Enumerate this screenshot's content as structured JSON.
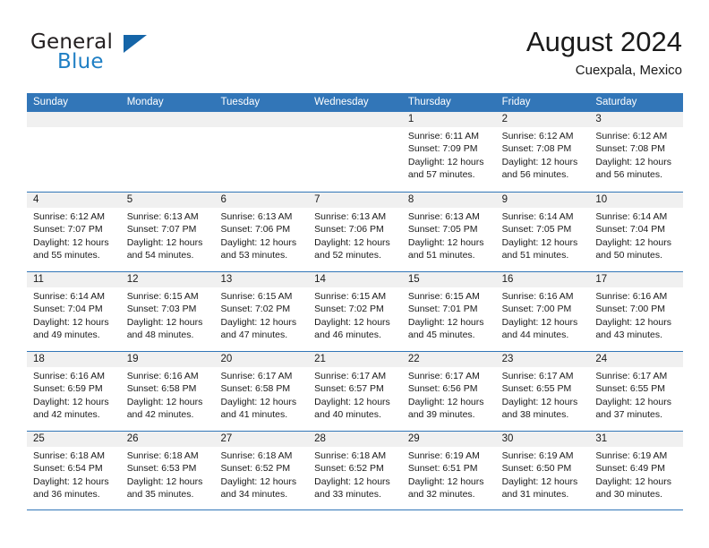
{
  "brand": {
    "line1": "General",
    "line2": "Blue",
    "logo_icon": "blue-triangle-logo",
    "accent_color": "#1f7fc4"
  },
  "header": {
    "title": "August 2024",
    "subtitle": "Cuexpala, Mexico"
  },
  "theme": {
    "header_blue": "#3276b8",
    "day_band_gray": "#f0f0f0",
    "text_color": "#1a1a1a"
  },
  "calendar": {
    "weekday_headers": [
      "Sunday",
      "Monday",
      "Tuesday",
      "Wednesday",
      "Thursday",
      "Friday",
      "Saturday"
    ],
    "weeks": [
      [
        {
          "day": "",
          "empty": true
        },
        {
          "day": "",
          "empty": true
        },
        {
          "day": "",
          "empty": true
        },
        {
          "day": "",
          "empty": true
        },
        {
          "day": "1",
          "sunrise": "Sunrise: 6:11 AM",
          "sunset": "Sunset: 7:09 PM",
          "daylight1": "Daylight: 12 hours",
          "daylight2": "and 57 minutes."
        },
        {
          "day": "2",
          "sunrise": "Sunrise: 6:12 AM",
          "sunset": "Sunset: 7:08 PM",
          "daylight1": "Daylight: 12 hours",
          "daylight2": "and 56 minutes."
        },
        {
          "day": "3",
          "sunrise": "Sunrise: 6:12 AM",
          "sunset": "Sunset: 7:08 PM",
          "daylight1": "Daylight: 12 hours",
          "daylight2": "and 56 minutes."
        }
      ],
      [
        {
          "day": "4",
          "sunrise": "Sunrise: 6:12 AM",
          "sunset": "Sunset: 7:07 PM",
          "daylight1": "Daylight: 12 hours",
          "daylight2": "and 55 minutes."
        },
        {
          "day": "5",
          "sunrise": "Sunrise: 6:13 AM",
          "sunset": "Sunset: 7:07 PM",
          "daylight1": "Daylight: 12 hours",
          "daylight2": "and 54 minutes."
        },
        {
          "day": "6",
          "sunrise": "Sunrise: 6:13 AM",
          "sunset": "Sunset: 7:06 PM",
          "daylight1": "Daylight: 12 hours",
          "daylight2": "and 53 minutes."
        },
        {
          "day": "7",
          "sunrise": "Sunrise: 6:13 AM",
          "sunset": "Sunset: 7:06 PM",
          "daylight1": "Daylight: 12 hours",
          "daylight2": "and 52 minutes."
        },
        {
          "day": "8",
          "sunrise": "Sunrise: 6:13 AM",
          "sunset": "Sunset: 7:05 PM",
          "daylight1": "Daylight: 12 hours",
          "daylight2": "and 51 minutes."
        },
        {
          "day": "9",
          "sunrise": "Sunrise: 6:14 AM",
          "sunset": "Sunset: 7:05 PM",
          "daylight1": "Daylight: 12 hours",
          "daylight2": "and 51 minutes."
        },
        {
          "day": "10",
          "sunrise": "Sunrise: 6:14 AM",
          "sunset": "Sunset: 7:04 PM",
          "daylight1": "Daylight: 12 hours",
          "daylight2": "and 50 minutes."
        }
      ],
      [
        {
          "day": "11",
          "sunrise": "Sunrise: 6:14 AM",
          "sunset": "Sunset: 7:04 PM",
          "daylight1": "Daylight: 12 hours",
          "daylight2": "and 49 minutes."
        },
        {
          "day": "12",
          "sunrise": "Sunrise: 6:15 AM",
          "sunset": "Sunset: 7:03 PM",
          "daylight1": "Daylight: 12 hours",
          "daylight2": "and 48 minutes."
        },
        {
          "day": "13",
          "sunrise": "Sunrise: 6:15 AM",
          "sunset": "Sunset: 7:02 PM",
          "daylight1": "Daylight: 12 hours",
          "daylight2": "and 47 minutes."
        },
        {
          "day": "14",
          "sunrise": "Sunrise: 6:15 AM",
          "sunset": "Sunset: 7:02 PM",
          "daylight1": "Daylight: 12 hours",
          "daylight2": "and 46 minutes."
        },
        {
          "day": "15",
          "sunrise": "Sunrise: 6:15 AM",
          "sunset": "Sunset: 7:01 PM",
          "daylight1": "Daylight: 12 hours",
          "daylight2": "and 45 minutes."
        },
        {
          "day": "16",
          "sunrise": "Sunrise: 6:16 AM",
          "sunset": "Sunset: 7:00 PM",
          "daylight1": "Daylight: 12 hours",
          "daylight2": "and 44 minutes."
        },
        {
          "day": "17",
          "sunrise": "Sunrise: 6:16 AM",
          "sunset": "Sunset: 7:00 PM",
          "daylight1": "Daylight: 12 hours",
          "daylight2": "and 43 minutes."
        }
      ],
      [
        {
          "day": "18",
          "sunrise": "Sunrise: 6:16 AM",
          "sunset": "Sunset: 6:59 PM",
          "daylight1": "Daylight: 12 hours",
          "daylight2": "and 42 minutes."
        },
        {
          "day": "19",
          "sunrise": "Sunrise: 6:16 AM",
          "sunset": "Sunset: 6:58 PM",
          "daylight1": "Daylight: 12 hours",
          "daylight2": "and 42 minutes."
        },
        {
          "day": "20",
          "sunrise": "Sunrise: 6:17 AM",
          "sunset": "Sunset: 6:58 PM",
          "daylight1": "Daylight: 12 hours",
          "daylight2": "and 41 minutes."
        },
        {
          "day": "21",
          "sunrise": "Sunrise: 6:17 AM",
          "sunset": "Sunset: 6:57 PM",
          "daylight1": "Daylight: 12 hours",
          "daylight2": "and 40 minutes."
        },
        {
          "day": "22",
          "sunrise": "Sunrise: 6:17 AM",
          "sunset": "Sunset: 6:56 PM",
          "daylight1": "Daylight: 12 hours",
          "daylight2": "and 39 minutes."
        },
        {
          "day": "23",
          "sunrise": "Sunrise: 6:17 AM",
          "sunset": "Sunset: 6:55 PM",
          "daylight1": "Daylight: 12 hours",
          "daylight2": "and 38 minutes."
        },
        {
          "day": "24",
          "sunrise": "Sunrise: 6:17 AM",
          "sunset": "Sunset: 6:55 PM",
          "daylight1": "Daylight: 12 hours",
          "daylight2": "and 37 minutes."
        }
      ],
      [
        {
          "day": "25",
          "sunrise": "Sunrise: 6:18 AM",
          "sunset": "Sunset: 6:54 PM",
          "daylight1": "Daylight: 12 hours",
          "daylight2": "and 36 minutes."
        },
        {
          "day": "26",
          "sunrise": "Sunrise: 6:18 AM",
          "sunset": "Sunset: 6:53 PM",
          "daylight1": "Daylight: 12 hours",
          "daylight2": "and 35 minutes."
        },
        {
          "day": "27",
          "sunrise": "Sunrise: 6:18 AM",
          "sunset": "Sunset: 6:52 PM",
          "daylight1": "Daylight: 12 hours",
          "daylight2": "and 34 minutes."
        },
        {
          "day": "28",
          "sunrise": "Sunrise: 6:18 AM",
          "sunset": "Sunset: 6:52 PM",
          "daylight1": "Daylight: 12 hours",
          "daylight2": "and 33 minutes."
        },
        {
          "day": "29",
          "sunrise": "Sunrise: 6:19 AM",
          "sunset": "Sunset: 6:51 PM",
          "daylight1": "Daylight: 12 hours",
          "daylight2": "and 32 minutes."
        },
        {
          "day": "30",
          "sunrise": "Sunrise: 6:19 AM",
          "sunset": "Sunset: 6:50 PM",
          "daylight1": "Daylight: 12 hours",
          "daylight2": "and 31 minutes."
        },
        {
          "day": "31",
          "sunrise": "Sunrise: 6:19 AM",
          "sunset": "Sunset: 6:49 PM",
          "daylight1": "Daylight: 12 hours",
          "daylight2": "and 30 minutes."
        }
      ]
    ]
  }
}
